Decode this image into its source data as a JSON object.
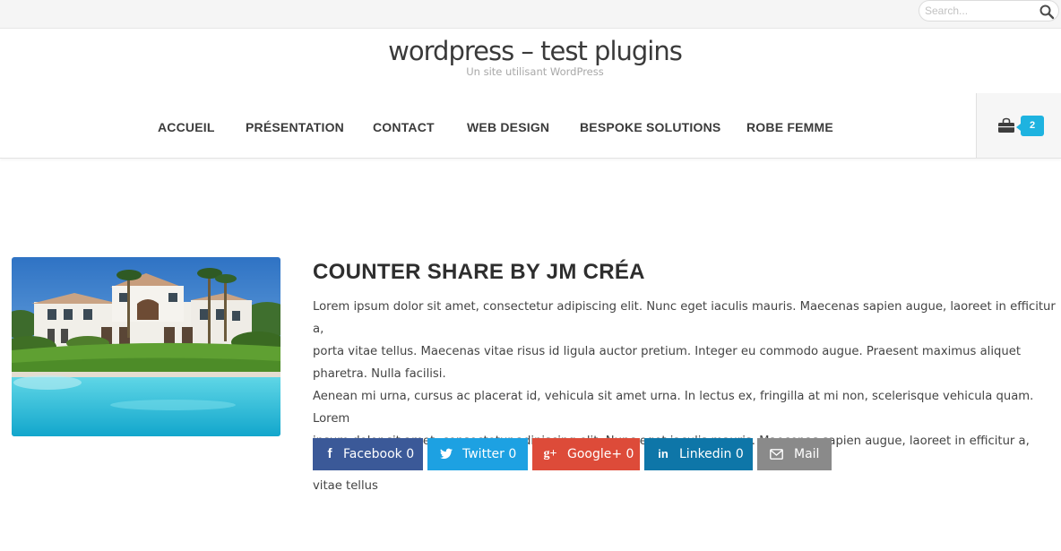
{
  "search": {
    "placeholder": "Search...",
    "value": ""
  },
  "site": {
    "title": "wordpress – test plugins",
    "tagline": "Un site utilisant WordPress"
  },
  "nav": {
    "items": [
      {
        "label": "ACCUEIL"
      },
      {
        "label": "PRÉSENTATION"
      },
      {
        "label": "CONTACT"
      },
      {
        "label": "WEB DESIGN"
      },
      {
        "label": "BESPOKE SOLUTIONS"
      },
      {
        "label": "ROBE FEMME"
      }
    ],
    "cart": {
      "count": "2",
      "icon": "shopping-bag-icon",
      "badge_color": "#1eb3e0"
    }
  },
  "post": {
    "image_icon": "villa-pool-photo",
    "title": "COUNTER SHARE BY JM CRÉA",
    "line1": "Lorem ipsum dolor sit amet, consectetur adipiscing elit. Nunc eget iaculis mauris. Maecenas sapien augue, laoreet in efficitur a,",
    "line2": "porta vitae tellus. Maecenas vitae risus id ligula auctor pretium. Integer eu commodo augue. Praesent maximus aliquet",
    "line3": "pharetra. Nulla facilisi.",
    "line4": "Aenean mi urna, cursus ac placerat id, vehicula sit amet urna. In lectus ex, fringilla at mi non, scelerisque vehicula quam. Lorem",
    "line5": "ipsum dolor sit amet, consectetur adipiscing elit. Nunc eget iaculis mauris. Maecenas sapien augue, laoreet in efficitur a, porta",
    "line6": "vitae tellus"
  },
  "share": {
    "facebook": {
      "label": "Facebook 0",
      "icon": "facebook-icon",
      "glyph": "f",
      "color": "#3b5998"
    },
    "twitter": {
      "label": "Twitter 0",
      "icon": "twitter-icon",
      "color": "#1da1e2"
    },
    "google": {
      "label": "Google+ 0",
      "icon": "google-plus-icon",
      "glyph": "g+",
      "color": "#dd4b39"
    },
    "linkedin": {
      "label": "Linkedin 0",
      "icon": "linkedin-icon",
      "glyph": "in",
      "color": "#0e76a8"
    },
    "mail": {
      "label": "Mail",
      "icon": "mail-icon",
      "color": "#8a8a8a"
    }
  }
}
